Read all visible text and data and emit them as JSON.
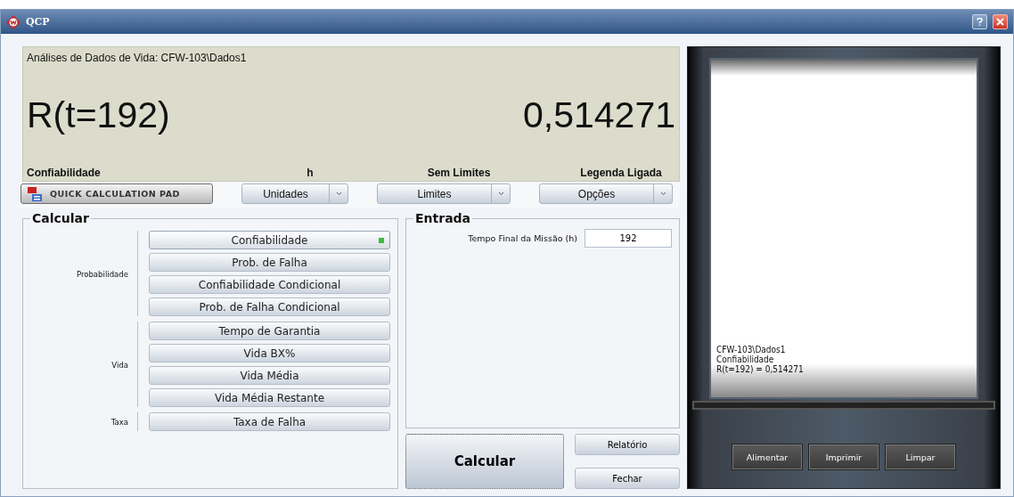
{
  "window": {
    "title": "QCP"
  },
  "display": {
    "header": "Análises de Dados de Vida: CFW-103\\Dados1",
    "expression": "R(t=192)",
    "result": "0,514271"
  },
  "settings": [
    {
      "kind": "logo",
      "label": "Confiabilidade",
      "control": "QUICK CALCULATION PAD"
    },
    {
      "kind": "dropdown",
      "label": "h",
      "control": "Unidades"
    },
    {
      "kind": "dropdown",
      "label": "Sem Limites",
      "control": "Limites"
    },
    {
      "kind": "dropdown",
      "label": "Legenda Ligada",
      "control": "Opções"
    }
  ],
  "calculate": {
    "title": "Calcular",
    "groups": [
      {
        "label": "Probabilidade",
        "items": [
          {
            "label": "Confiabilidade",
            "selected": true
          },
          {
            "label": "Prob. de Falha",
            "selected": false
          },
          {
            "label": "Confiabilidade Condicional",
            "selected": false
          },
          {
            "label": "Prob. de Falha Condicional",
            "selected": false
          }
        ]
      },
      {
        "label": "Vida",
        "items": [
          {
            "label": "Tempo de Garantia",
            "selected": false
          },
          {
            "label": "Vida BX%",
            "selected": false
          },
          {
            "label": "Vida Média",
            "selected": false
          },
          {
            "label": "Vida Média Restante",
            "selected": false
          }
        ]
      },
      {
        "label": "Taxa",
        "items": [
          {
            "label": "Taxa de Falha",
            "selected": false
          }
        ]
      }
    ]
  },
  "input": {
    "title": "Entrada",
    "fields": [
      {
        "label": "Tempo Final da Missão (h)",
        "value": "192"
      }
    ]
  },
  "actions": {
    "primary": "Calcular",
    "secondary": [
      "Relatório",
      "Fechar"
    ]
  },
  "printer": {
    "output": [
      "CFW-103\\Dados1",
      "Confiabilidade",
      "R(t=192) = 0,514271"
    ],
    "buttons": [
      "Alimentar",
      "Imprimir",
      "Limpar"
    ]
  }
}
